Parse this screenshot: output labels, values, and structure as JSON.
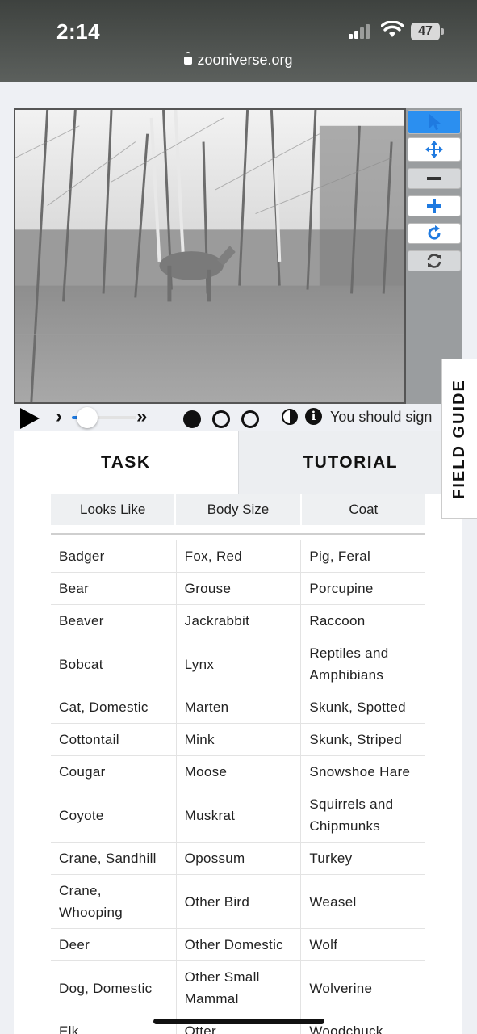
{
  "status_bar": {
    "time": "2:14",
    "battery": "47"
  },
  "browser": {
    "url": "zooniverse.org"
  },
  "viewer": {
    "tools": [
      "pointer-icon",
      "move-icon",
      "zoom-out-icon",
      "zoom-in-icon",
      "rotate-icon",
      "reset-icon"
    ]
  },
  "playback": {
    "slider_level": 0.18,
    "signin_text": "You should sign"
  },
  "tabs": {
    "task": "TASK",
    "tutorial": "TUTORIAL"
  },
  "filters": [
    "Looks Like",
    "Body Size",
    "Coat"
  ],
  "species_rows": [
    [
      "Badger",
      "Fox, Red",
      "Pig, Feral"
    ],
    [
      "Bear",
      "Grouse",
      "Porcupine"
    ],
    [
      "Beaver",
      "Jackrabbit",
      "Raccoon"
    ],
    [
      "Bobcat",
      "Lynx",
      "Reptiles and Amphibians"
    ],
    [
      "Cat, Domestic",
      "Marten",
      "Skunk, Spotted"
    ],
    [
      "Cottontail",
      "Mink",
      "Skunk, Striped"
    ],
    [
      "Cougar",
      "Moose",
      "Snowshoe Hare"
    ],
    [
      "Coyote",
      "Muskrat",
      "Squirrels and Chipmunks"
    ],
    [
      "Crane, Sandhill",
      "Opossum",
      "Turkey"
    ],
    [
      "Crane, Whooping",
      "Other Bird",
      "Weasel"
    ],
    [
      "Deer",
      "Other Domestic",
      "Wolf"
    ],
    [
      "Dog, Domestic",
      "Other Small Mammal",
      "Wolverine"
    ],
    [
      "Elk",
      "Otter",
      "Woodchuck"
    ]
  ],
  "field_guide": "FIELD GUIDE",
  "colors": {
    "accent": "#1f7ae0",
    "active_tool": "#2b8ff0",
    "toolbar": "#9a9d9f"
  }
}
